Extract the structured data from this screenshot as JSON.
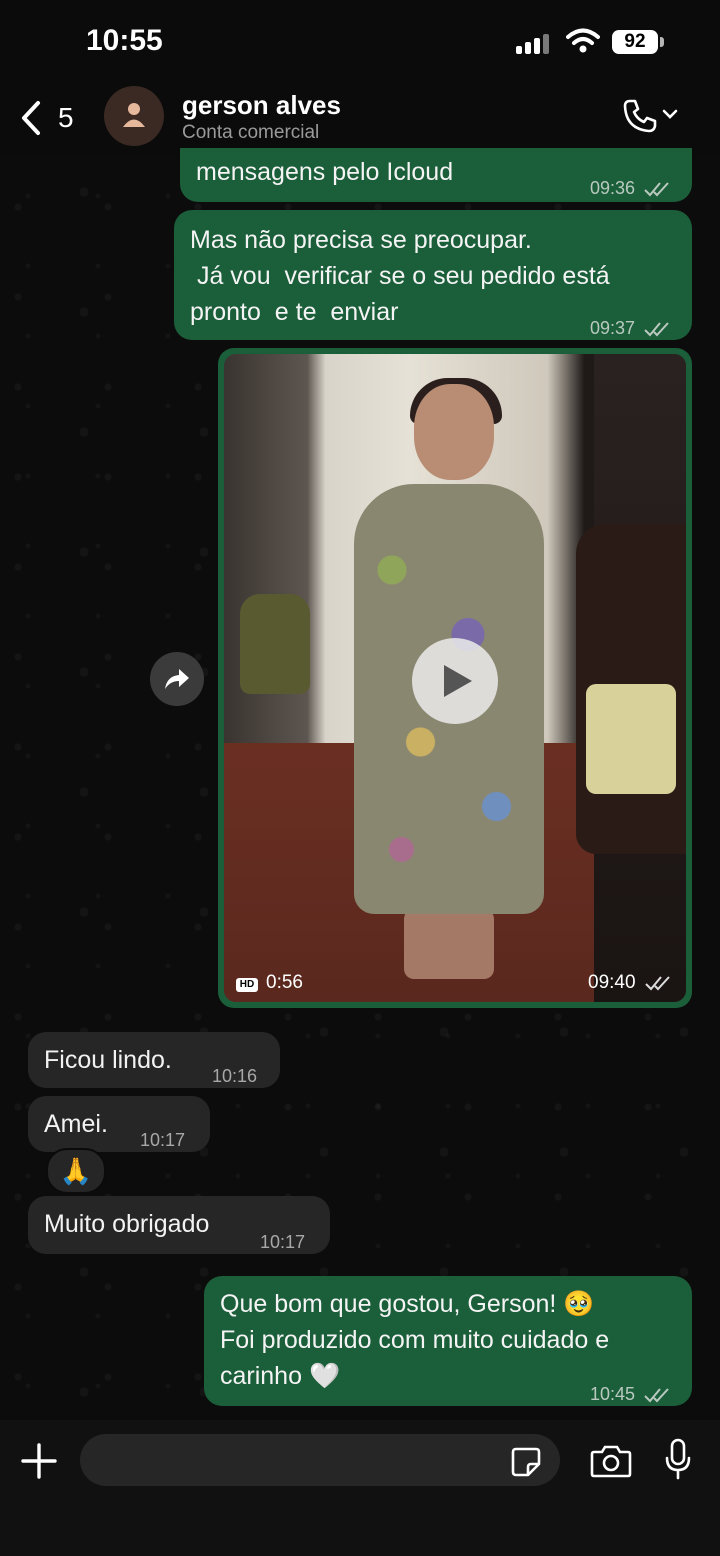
{
  "status_bar": {
    "time": "10:55",
    "battery": "92"
  },
  "header": {
    "back_count": "5",
    "contact_name": "gerson alves",
    "contact_subtitle": "Conta comercial",
    "icons": [
      "back-chevron-icon",
      "avatar-person-icon",
      "phone-icon",
      "chevron-down-icon"
    ]
  },
  "messages": [
    {
      "direction": "out",
      "text": "mensagens pelo Icloud",
      "time": "09:36",
      "status": "read"
    },
    {
      "direction": "out",
      "lines": [
        "Mas não precisa se preocupar.",
        " Já vou  verificar se o seu pedido está",
        "pronto  e te  enviar"
      ],
      "time": "09:37",
      "status": "read"
    },
    {
      "direction": "out",
      "type": "video",
      "hd_label": "HD",
      "duration": "0:56",
      "time": "09:40",
      "status": "read"
    },
    {
      "direction": "in",
      "text": "Ficou lindo.",
      "time": "10:16"
    },
    {
      "direction": "in",
      "text": "Amei.",
      "time": "10:17",
      "reaction": "🙏"
    },
    {
      "direction": "in",
      "text": "Muito obrigado",
      "time": "10:17"
    },
    {
      "direction": "out",
      "lines": [
        "Que bom que gostou, Gerson! 🥹",
        "Foi produzido com muito cuidado e",
        "carinho 🤍"
      ],
      "time": "10:45",
      "status": "read"
    }
  ],
  "composer": {
    "placeholder": ""
  },
  "colors": {
    "outgoing_bubble": "#1b5e3a",
    "incoming_bubble": "#262626",
    "background": "#0b0b0b"
  }
}
